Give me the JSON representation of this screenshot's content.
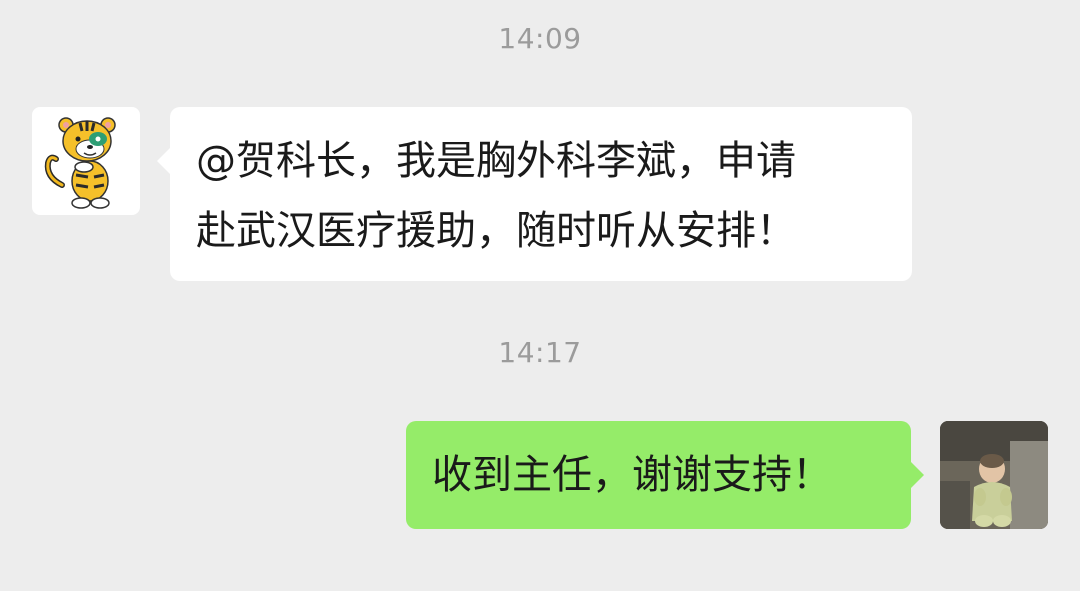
{
  "messages": [
    {
      "timestamp": "14:09",
      "sender": "other",
      "avatar_icon": "cartoon-tiger-icon",
      "lines": [
        "@贺科长，我是胸外科李斌，申请",
        "赴武汉医疗援助，随时听从安排！"
      ],
      "bubble_color": "#ffffff"
    },
    {
      "timestamp": "14:17",
      "sender": "self",
      "avatar_icon": "baby-photo-avatar",
      "lines": [
        "收到主任，谢谢支持！"
      ],
      "bubble_color": "#95ec69"
    }
  ],
  "colors": {
    "background": "#ededed",
    "timestamp_text": "#9b9b9b",
    "incoming_bubble": "#ffffff",
    "outgoing_bubble": "#95ec69"
  }
}
